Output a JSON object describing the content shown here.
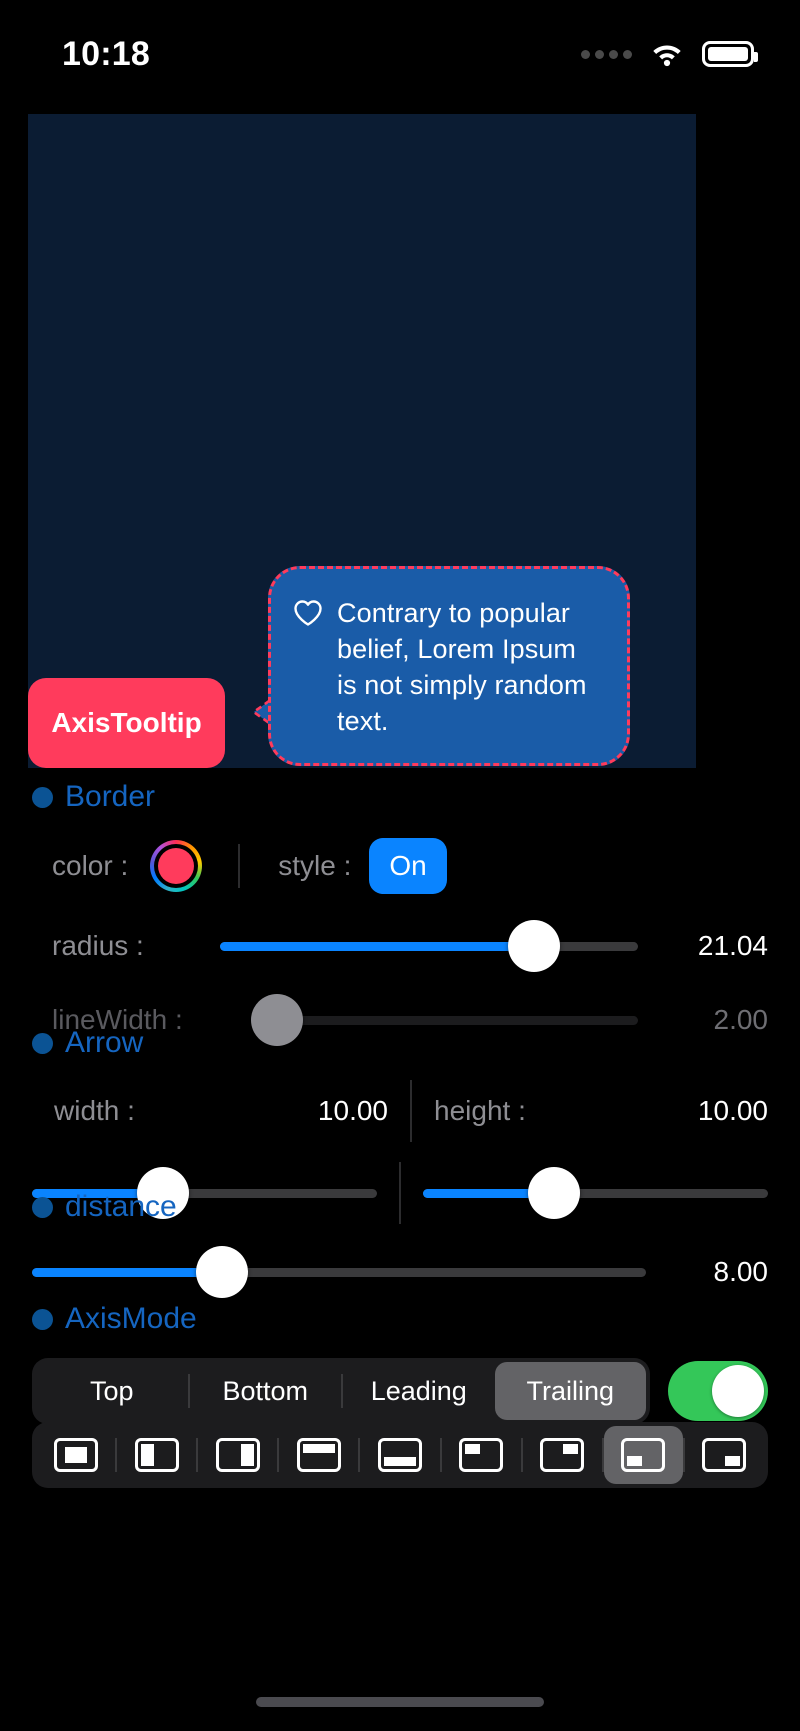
{
  "status_bar": {
    "time": "10:18",
    "signal_icon": "signal-dots-icon",
    "wifi_icon": "wifi-icon",
    "battery_icon": "battery-full-icon"
  },
  "preview": {
    "background_color": "#0b1c33",
    "anchor_button": {
      "label": "AxisTooltip",
      "background_color": "#ff3b5c",
      "text_color": "#ffffff"
    },
    "tooltip": {
      "text": "Contrary to popular belief, Lorem Ipsum is not simply random text.",
      "icon": "heart-icon",
      "fill_color": "#1a5ca8",
      "border_color": "#ff3b5c",
      "border_style": "dashed",
      "text_color": "#ffffff"
    }
  },
  "sections": {
    "border": {
      "title": "Border",
      "color_label": "color :",
      "color_value": "#ff3b5c",
      "style_label": "style :",
      "style_value": "On",
      "radius": {
        "label": "radius :",
        "value": "21.04",
        "percent": 75
      },
      "line_width": {
        "label": "lineWidth :",
        "value": "2.00",
        "percent": 5,
        "disabled": true
      }
    },
    "arrow": {
      "title": "Arrow",
      "width": {
        "label": "width :",
        "value": "10.00",
        "percent": 38
      },
      "height": {
        "label": "height :",
        "value": "10.00",
        "percent": 38
      }
    },
    "distance": {
      "title": "distance",
      "value": "8.00",
      "percent": 31
    },
    "axis_mode": {
      "title": "AxisMode",
      "options": [
        "Top",
        "Bottom",
        "Leading",
        "Trailing"
      ],
      "selected": "Trailing",
      "toggle_on": true,
      "toggle_color": "#34c759"
    }
  },
  "alignment_bar": {
    "icons": [
      "align-center-icon",
      "align-left-icon",
      "align-right-icon",
      "align-top-icon",
      "align-bottom-icon",
      "align-top-left-icon",
      "align-top-right-icon",
      "align-bottom-left-icon",
      "align-bottom-right-icon"
    ],
    "selected_index": 7
  },
  "accent_colors": {
    "section_title": "#1565c0",
    "section_dot": "#0b5394",
    "slider_fill": "#0a84ff",
    "label": "#8e8e93"
  }
}
